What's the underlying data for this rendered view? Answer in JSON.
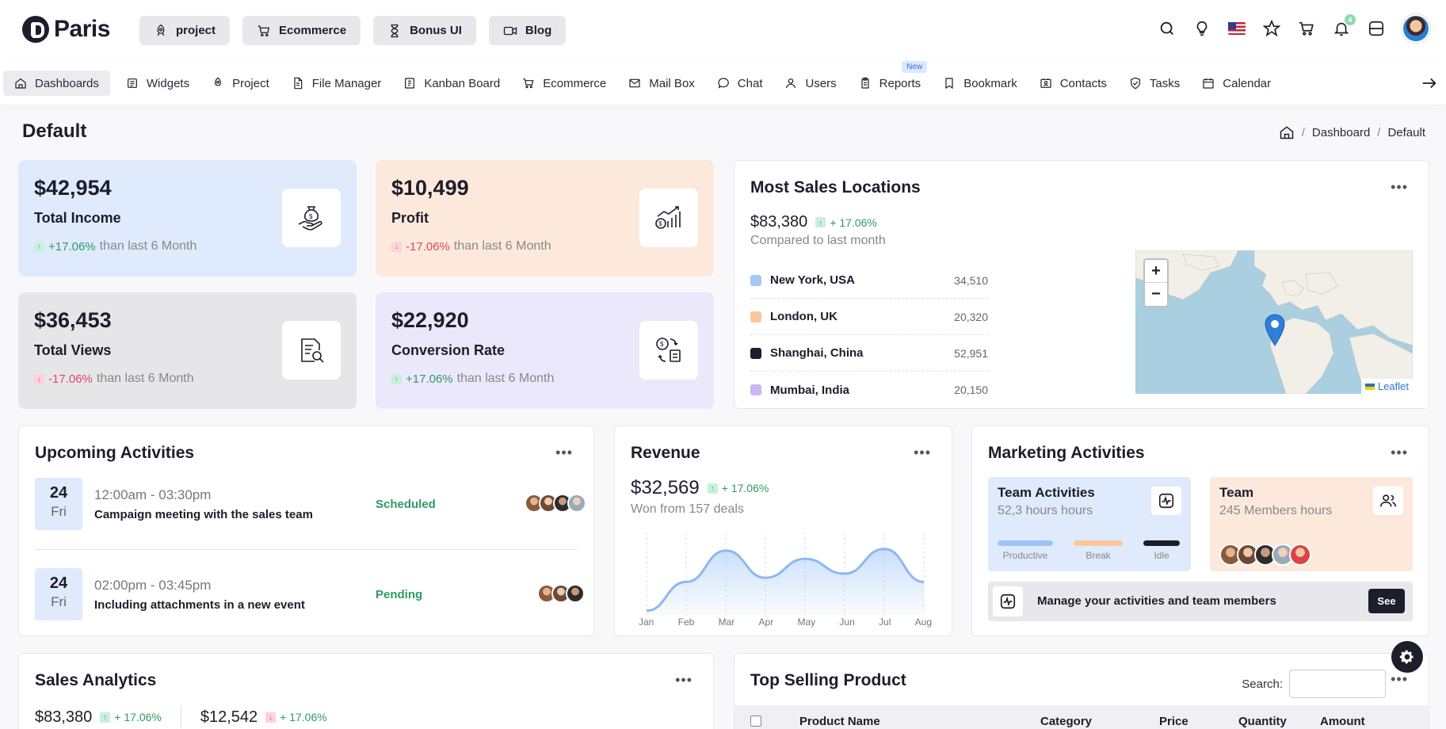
{
  "app": {
    "logo": "Paris"
  },
  "quick_links": [
    {
      "label": "project",
      "icon": "rocket-icon"
    },
    {
      "label": "Ecommerce",
      "icon": "cart-icon"
    },
    {
      "label": "Bonus UI",
      "icon": "hourglass-icon"
    },
    {
      "label": "Blog",
      "icon": "video-icon"
    }
  ],
  "header": {
    "notification_count": "4"
  },
  "nav": [
    {
      "label": "Dashboards",
      "icon": "home-icon"
    },
    {
      "label": "Widgets",
      "icon": "widgets-icon"
    },
    {
      "label": "Project",
      "icon": "rocket-icon"
    },
    {
      "label": "File Manager",
      "icon": "file-icon"
    },
    {
      "label": "Kanban Board",
      "icon": "kanban-icon"
    },
    {
      "label": "Ecommerce",
      "icon": "cart-icon"
    },
    {
      "label": "Mail Box",
      "icon": "mail-icon"
    },
    {
      "label": "Chat",
      "icon": "chat-icon"
    },
    {
      "label": "Users",
      "icon": "user-icon"
    },
    {
      "label": "Reports",
      "icon": "report-icon",
      "badge": "New"
    },
    {
      "label": "Bookmark",
      "icon": "bookmark-icon"
    },
    {
      "label": "Contacts",
      "icon": "contacts-icon"
    },
    {
      "label": "Tasks",
      "icon": "shield-check-icon"
    },
    {
      "label": "Calendar",
      "icon": "calendar-icon"
    }
  ],
  "page": {
    "title": "Default",
    "breadcrumb": [
      "Dashboard",
      "Default"
    ]
  },
  "stats": [
    {
      "value": "$42,954",
      "label": "Total Income",
      "pct": "+17.06%",
      "dir": "up",
      "suffix": "than last 6 Month",
      "bg": "#dfeafc",
      "icon": "money-bag-hand-icon"
    },
    {
      "value": "$10,499",
      "label": "Profit",
      "pct": "-17.06%",
      "dir": "down",
      "suffix": "than last 6 Month",
      "bg": "#fde9dc",
      "icon": "growth-chart-icon"
    },
    {
      "value": "$36,453",
      "label": "Total Views",
      "pct": "-17.06%",
      "dir": "down",
      "suffix": "than last 6 Month",
      "bg": "#e6e6e8",
      "icon": "document-search-icon"
    },
    {
      "value": "$22,920",
      "label": "Conversion Rate",
      "pct": "+17.06%",
      "dir": "up",
      "suffix": "than last 6 Month",
      "bg": "#ece8fb",
      "icon": "currency-exchange-icon"
    }
  ],
  "sales_locations": {
    "title": "Most Sales Locations",
    "value": "$83,380",
    "pct": "+ 17.06%",
    "subtitle": "Compared to last month",
    "rows": [
      {
        "name": "New York, USA",
        "value": "34,510",
        "color": "#a5c8f5"
      },
      {
        "name": "London, UK",
        "value": "20,320",
        "color": "#fbc79a"
      },
      {
        "name": "Shanghai, China",
        "value": "52,951",
        "color": "#1d1d2b"
      },
      {
        "name": "Mumbai, India",
        "value": "20,150",
        "color": "#c9b6f2"
      }
    ],
    "map": {
      "zoom_in": "+",
      "zoom_out": "−",
      "attribution": "Leaflet"
    }
  },
  "upcoming": {
    "title": "Upcoming Activities",
    "rows": [
      {
        "day": "24",
        "weekday": "Fri",
        "time": "12:00am - 03:30pm",
        "desc": "Campaign meeting with the sales team",
        "status": "Scheduled"
      },
      {
        "day": "24",
        "weekday": "Fri",
        "time": "02:00pm - 03:45pm",
        "desc": "Including attachments in a new event",
        "status": "Pending"
      }
    ]
  },
  "revenue": {
    "title": "Revenue",
    "value": "$32,569",
    "pct": "+ 17.06%",
    "subtitle": "Won from 157 deals",
    "chart_data": {
      "type": "area",
      "categories": [
        "Jan",
        "Feb",
        "Mar",
        "Apr",
        "May",
        "Jun",
        "Jul",
        "Aug"
      ],
      "values": [
        5,
        40,
        78,
        45,
        68,
        50,
        80,
        40
      ],
      "ylim": [
        0,
        100
      ]
    }
  },
  "marketing": {
    "title": "Marketing Activities",
    "team_activities": {
      "title": "Team Activities",
      "subtitle": "52,3 hours hours",
      "bars": [
        {
          "label": "Productive",
          "color": "#9ec4f7"
        },
        {
          "label": "Break",
          "color": "#fbc79a"
        },
        {
          "label": "Idle",
          "color": "#1d1d2b"
        }
      ]
    },
    "team": {
      "title": "Team",
      "subtitle": "245 Members hours"
    },
    "manage_text": "Manage your activities and team members",
    "see_label": "See"
  },
  "sales_analytics": {
    "title": "Sales Analytics",
    "value1": "$83,380",
    "pct1": "+ 17.06%",
    "value2": "$12,542",
    "pct2": "+ 17.06%"
  },
  "top_selling": {
    "title": "Top Selling Product",
    "search_label": "Search:",
    "search_value": "",
    "columns": [
      "Product Name",
      "Category",
      "Price",
      "Quantity",
      "Amount"
    ]
  }
}
